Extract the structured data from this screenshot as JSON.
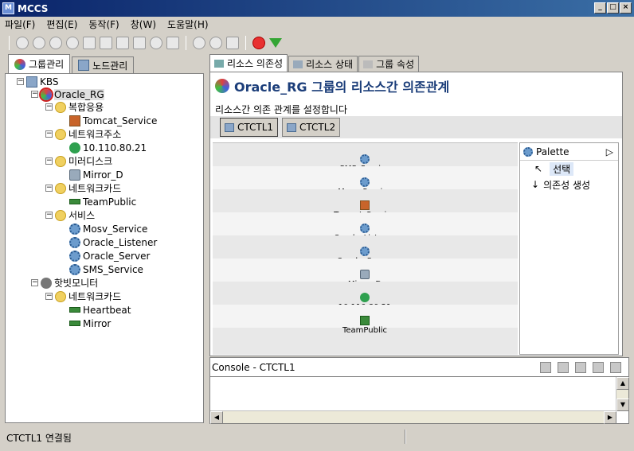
{
  "window": {
    "title": "MCCS",
    "app_icon": "M"
  },
  "menu": [
    "파일(F)",
    "편집(E)",
    "동작(F)",
    "창(W)",
    "도움말(H)"
  ],
  "left_tabs": [
    {
      "label": "그룹관리",
      "active": true
    },
    {
      "label": "노드관리",
      "active": false
    }
  ],
  "tree": {
    "root": "KBS",
    "group": "Oracle_RG",
    "items": [
      {
        "label": "복합응용",
        "level": 2,
        "icon": "folder-icon"
      },
      {
        "label": "Tomcat_Service",
        "level": 3,
        "icon": "app-icon"
      },
      {
        "label": "네트워크주소",
        "level": 2,
        "icon": "folder-icon"
      },
      {
        "label": "10.110.80.21",
        "level": 3,
        "icon": "globe-icon"
      },
      {
        "label": "미러디스크",
        "level": 2,
        "icon": "folder-icon"
      },
      {
        "label": "Mirror_D",
        "level": 3,
        "icon": "disk-icon"
      },
      {
        "label": "네트워크카드",
        "level": 2,
        "icon": "folder-icon"
      },
      {
        "label": "TeamPublic",
        "level": 3,
        "icon": "nic-icon"
      },
      {
        "label": "서비스",
        "level": 2,
        "icon": "folder-icon"
      },
      {
        "label": "Mosv_Service",
        "level": 3,
        "icon": "gear-icon"
      },
      {
        "label": "Oracle_Listener",
        "level": 3,
        "icon": "gear-icon"
      },
      {
        "label": "Oracle_Server",
        "level": 3,
        "icon": "gear-icon"
      },
      {
        "label": "SMS_Service",
        "level": 3,
        "icon": "gear-icon"
      }
    ],
    "heartbeat_group": "핫빗모니터",
    "heartbeat_items": [
      {
        "label": "네트워크카드",
        "level": 2,
        "icon": "folder-icon"
      },
      {
        "label": "Heartbeat",
        "level": 3,
        "icon": "nic-icon"
      },
      {
        "label": "Mirror",
        "level": 3,
        "icon": "nic-icon"
      }
    ]
  },
  "right_tabs": [
    {
      "label": "리소스 의존성",
      "active": true
    },
    {
      "label": "리소스 상태",
      "active": false
    },
    {
      "label": "그룹 속성",
      "active": false
    }
  ],
  "panel": {
    "title": "Oracle_RG 그룹의 리소스간 의존관계",
    "description": "리소스간 의존 관계를 설정합니다",
    "node_tabs": [
      {
        "label": "CTCTL1",
        "active": true
      },
      {
        "label": "CTCTL2",
        "active": false
      }
    ]
  },
  "diagram_nodes": [
    {
      "label": "SMS_Service",
      "icon": "gear-icon"
    },
    {
      "label": "Mosv_Service",
      "icon": "gear-icon"
    },
    {
      "label": "Tomcat_Service",
      "icon": "app-icon"
    },
    {
      "label": "Oracle_Listener",
      "icon": "gear-icon"
    },
    {
      "label": "Oracle_Server",
      "icon": "gear-icon"
    },
    {
      "label": "Mirror_D",
      "icon": "disk-icon"
    },
    {
      "label": "10.110.80.21",
      "icon": "globe-icon"
    },
    {
      "label": "TeamPublic",
      "icon": "nic-icon"
    }
  ],
  "palette": {
    "title": "Palette",
    "items": [
      "선택",
      "의존성 생성"
    ]
  },
  "console": {
    "title": "Console - CTCTL1"
  },
  "status": {
    "text": "CTCTL1 연결됨"
  }
}
